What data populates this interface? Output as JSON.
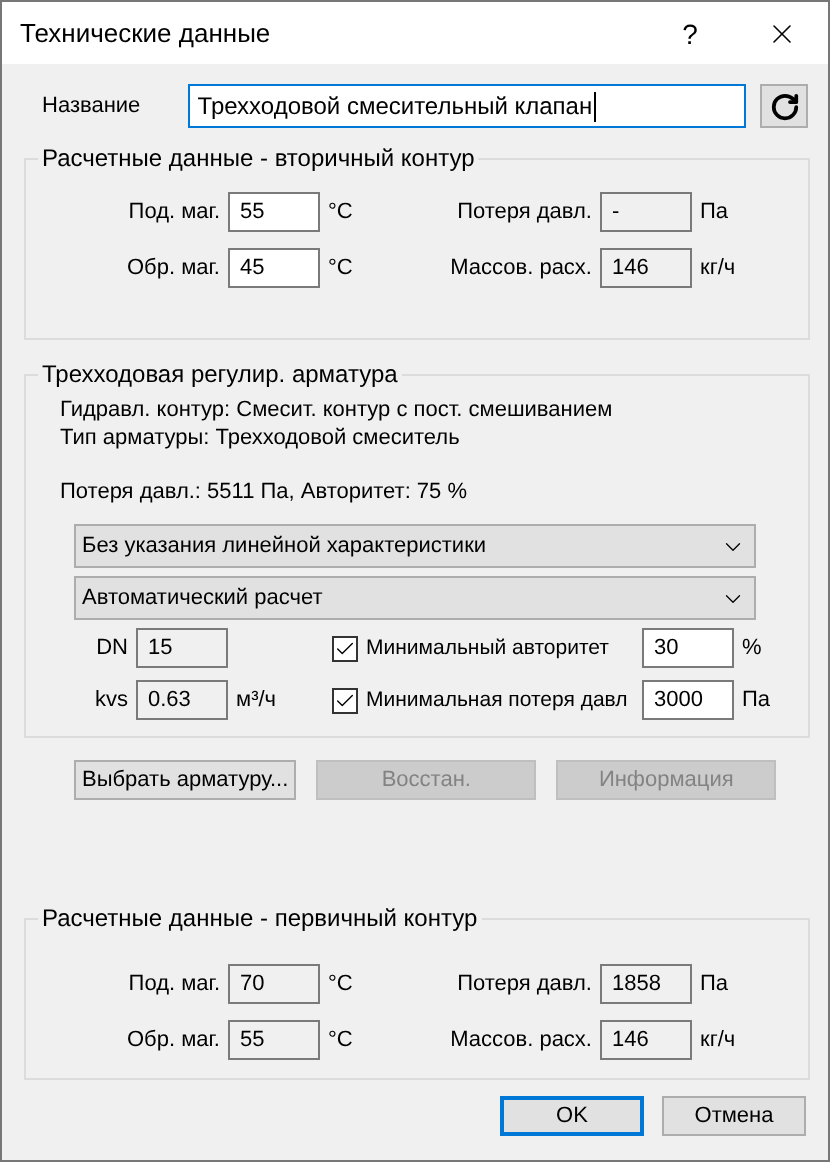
{
  "window": {
    "title": "Технические данные",
    "help": "?"
  },
  "name": {
    "label": "Название",
    "value": "Трехходовой смесительный клапан"
  },
  "secondary": {
    "title": "Расчетные данные - вторичный контур",
    "left": [
      {
        "label": "Под. маг.",
        "value": "55",
        "unit": "°C",
        "disabled": false
      },
      {
        "label": "Обр. маг.",
        "value": "45",
        "unit": "°C",
        "disabled": false
      }
    ],
    "right": [
      {
        "label": "Потеря давл.",
        "value": "-",
        "unit": "Па",
        "disabled": true
      },
      {
        "label": "Массов. расх.",
        "value": "146",
        "unit": "кг/ч",
        "disabled": true
      }
    ]
  },
  "valve": {
    "title": "Трехходовая регулир. арматура",
    "info": [
      "Гидравл. контур: Смесит. контур с пост. смешиванием",
      "Тип арматуры: Трехходовой смеситель"
    ],
    "summary": "Потеря давл.: 5511 Па, Авторитет: 75 %",
    "dropdowns": [
      "Без указания линейной характеристики",
      "Автоматический расчет"
    ],
    "params": [
      {
        "label": "DN",
        "value": "15",
        "disabled": true
      },
      {
        "label": "kvs",
        "value": "0.63",
        "unit": "м³/ч",
        "disabled": true
      }
    ],
    "options": [
      {
        "label": "Минимальный авторитет",
        "checked": true,
        "value": "30",
        "unit": "%"
      },
      {
        "label": "Минимальная потеря давл",
        "checked": true,
        "value": "3000",
        "unit": "Па"
      }
    ]
  },
  "buttons": [
    {
      "label": "Выбрать арматуру...",
      "disabled": false
    },
    {
      "label": "Восстан.",
      "disabled": true
    },
    {
      "label": "Информация",
      "disabled": true
    }
  ],
  "primary": {
    "title": "Расчетные данные - первичный контур",
    "left": [
      {
        "label": "Под. маг.",
        "value": "70",
        "unit": "°C",
        "disabled": true
      },
      {
        "label": "Обр. маг.",
        "value": "55",
        "unit": "°C",
        "disabled": true
      }
    ],
    "right": [
      {
        "label": "Потеря давл.",
        "value": "1858",
        "unit": "Па",
        "disabled": true
      },
      {
        "label": "Массов. расх.",
        "value": "146",
        "unit": "кг/ч",
        "disabled": true
      }
    ]
  },
  "footer": [
    {
      "label": "OK",
      "default": true
    },
    {
      "label": "Отмена",
      "default": false
    }
  ]
}
